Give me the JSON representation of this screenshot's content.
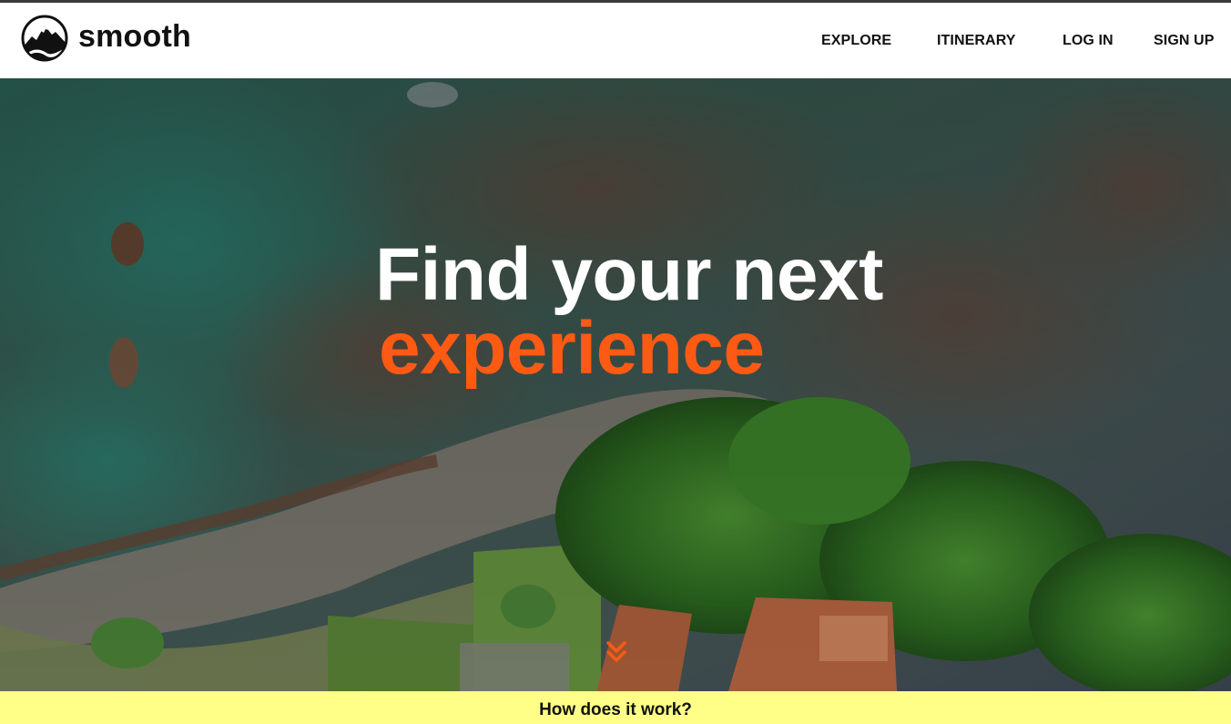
{
  "brand": {
    "name": "smooth",
    "logo_icon": "mountain-logo-icon"
  },
  "nav": {
    "items": [
      {
        "label": "EXPLORE"
      },
      {
        "label": "ITINERARY"
      },
      {
        "label": "LOG IN"
      },
      {
        "label": "SIGN UP"
      }
    ]
  },
  "hero": {
    "headline_line1": "Find your next",
    "headline_line2": "experience",
    "background": "aerial-coastline-photo",
    "scroll_icon": "double-chevron-down-icon"
  },
  "how_it_works": {
    "label": "How does it work?"
  },
  "colors": {
    "accent": "#ff5a14",
    "how_bar_bg": "#ffff88",
    "nav_text": "#111111",
    "header_bg": "#ffffff"
  }
}
